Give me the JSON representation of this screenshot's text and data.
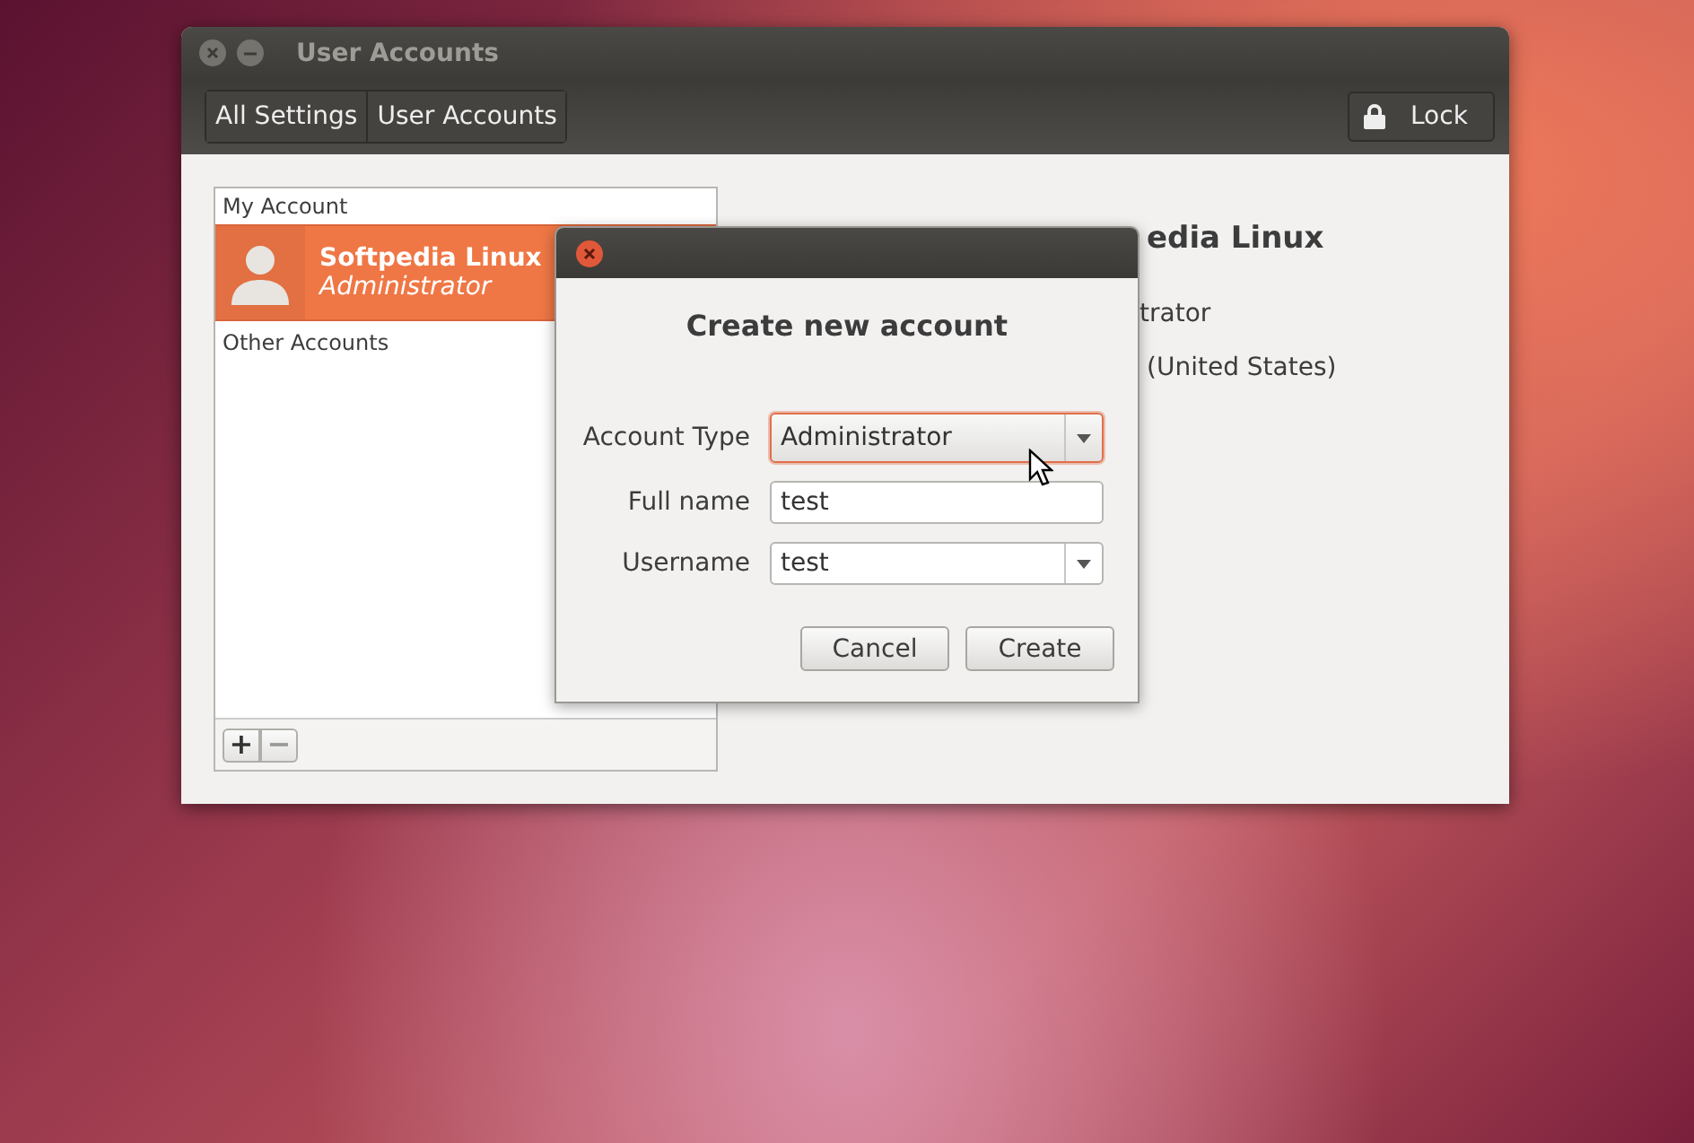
{
  "window": {
    "title": "User Accounts"
  },
  "toolbar": {
    "breadcrumbs": [
      {
        "label": "All Settings"
      },
      {
        "label": "User Accounts"
      }
    ],
    "lock_button": "Lock"
  },
  "accounts": {
    "my_account_heading": "My Account",
    "my_accounts": [
      {
        "name": "Softpedia Linux",
        "role": "Administrator",
        "selected": true
      }
    ],
    "other_accounts_heading": "Other Accounts",
    "list_buttons": [
      "+",
      "−"
    ]
  },
  "details": {
    "name": "edia Linux",
    "account_type": "trator",
    "language": "(United States)"
  },
  "dialog": {
    "title": "Create new account",
    "fields": [
      {
        "kind": "combo",
        "label": "Account Type",
        "value": "Administrator",
        "focused": true
      },
      {
        "kind": "entry",
        "label": "Full name",
        "value": "test",
        "focused": false
      },
      {
        "kind": "combo_entry",
        "label": "Username",
        "value": "test",
        "focused": false
      }
    ],
    "buttons": [
      "Cancel",
      "Create"
    ]
  }
}
